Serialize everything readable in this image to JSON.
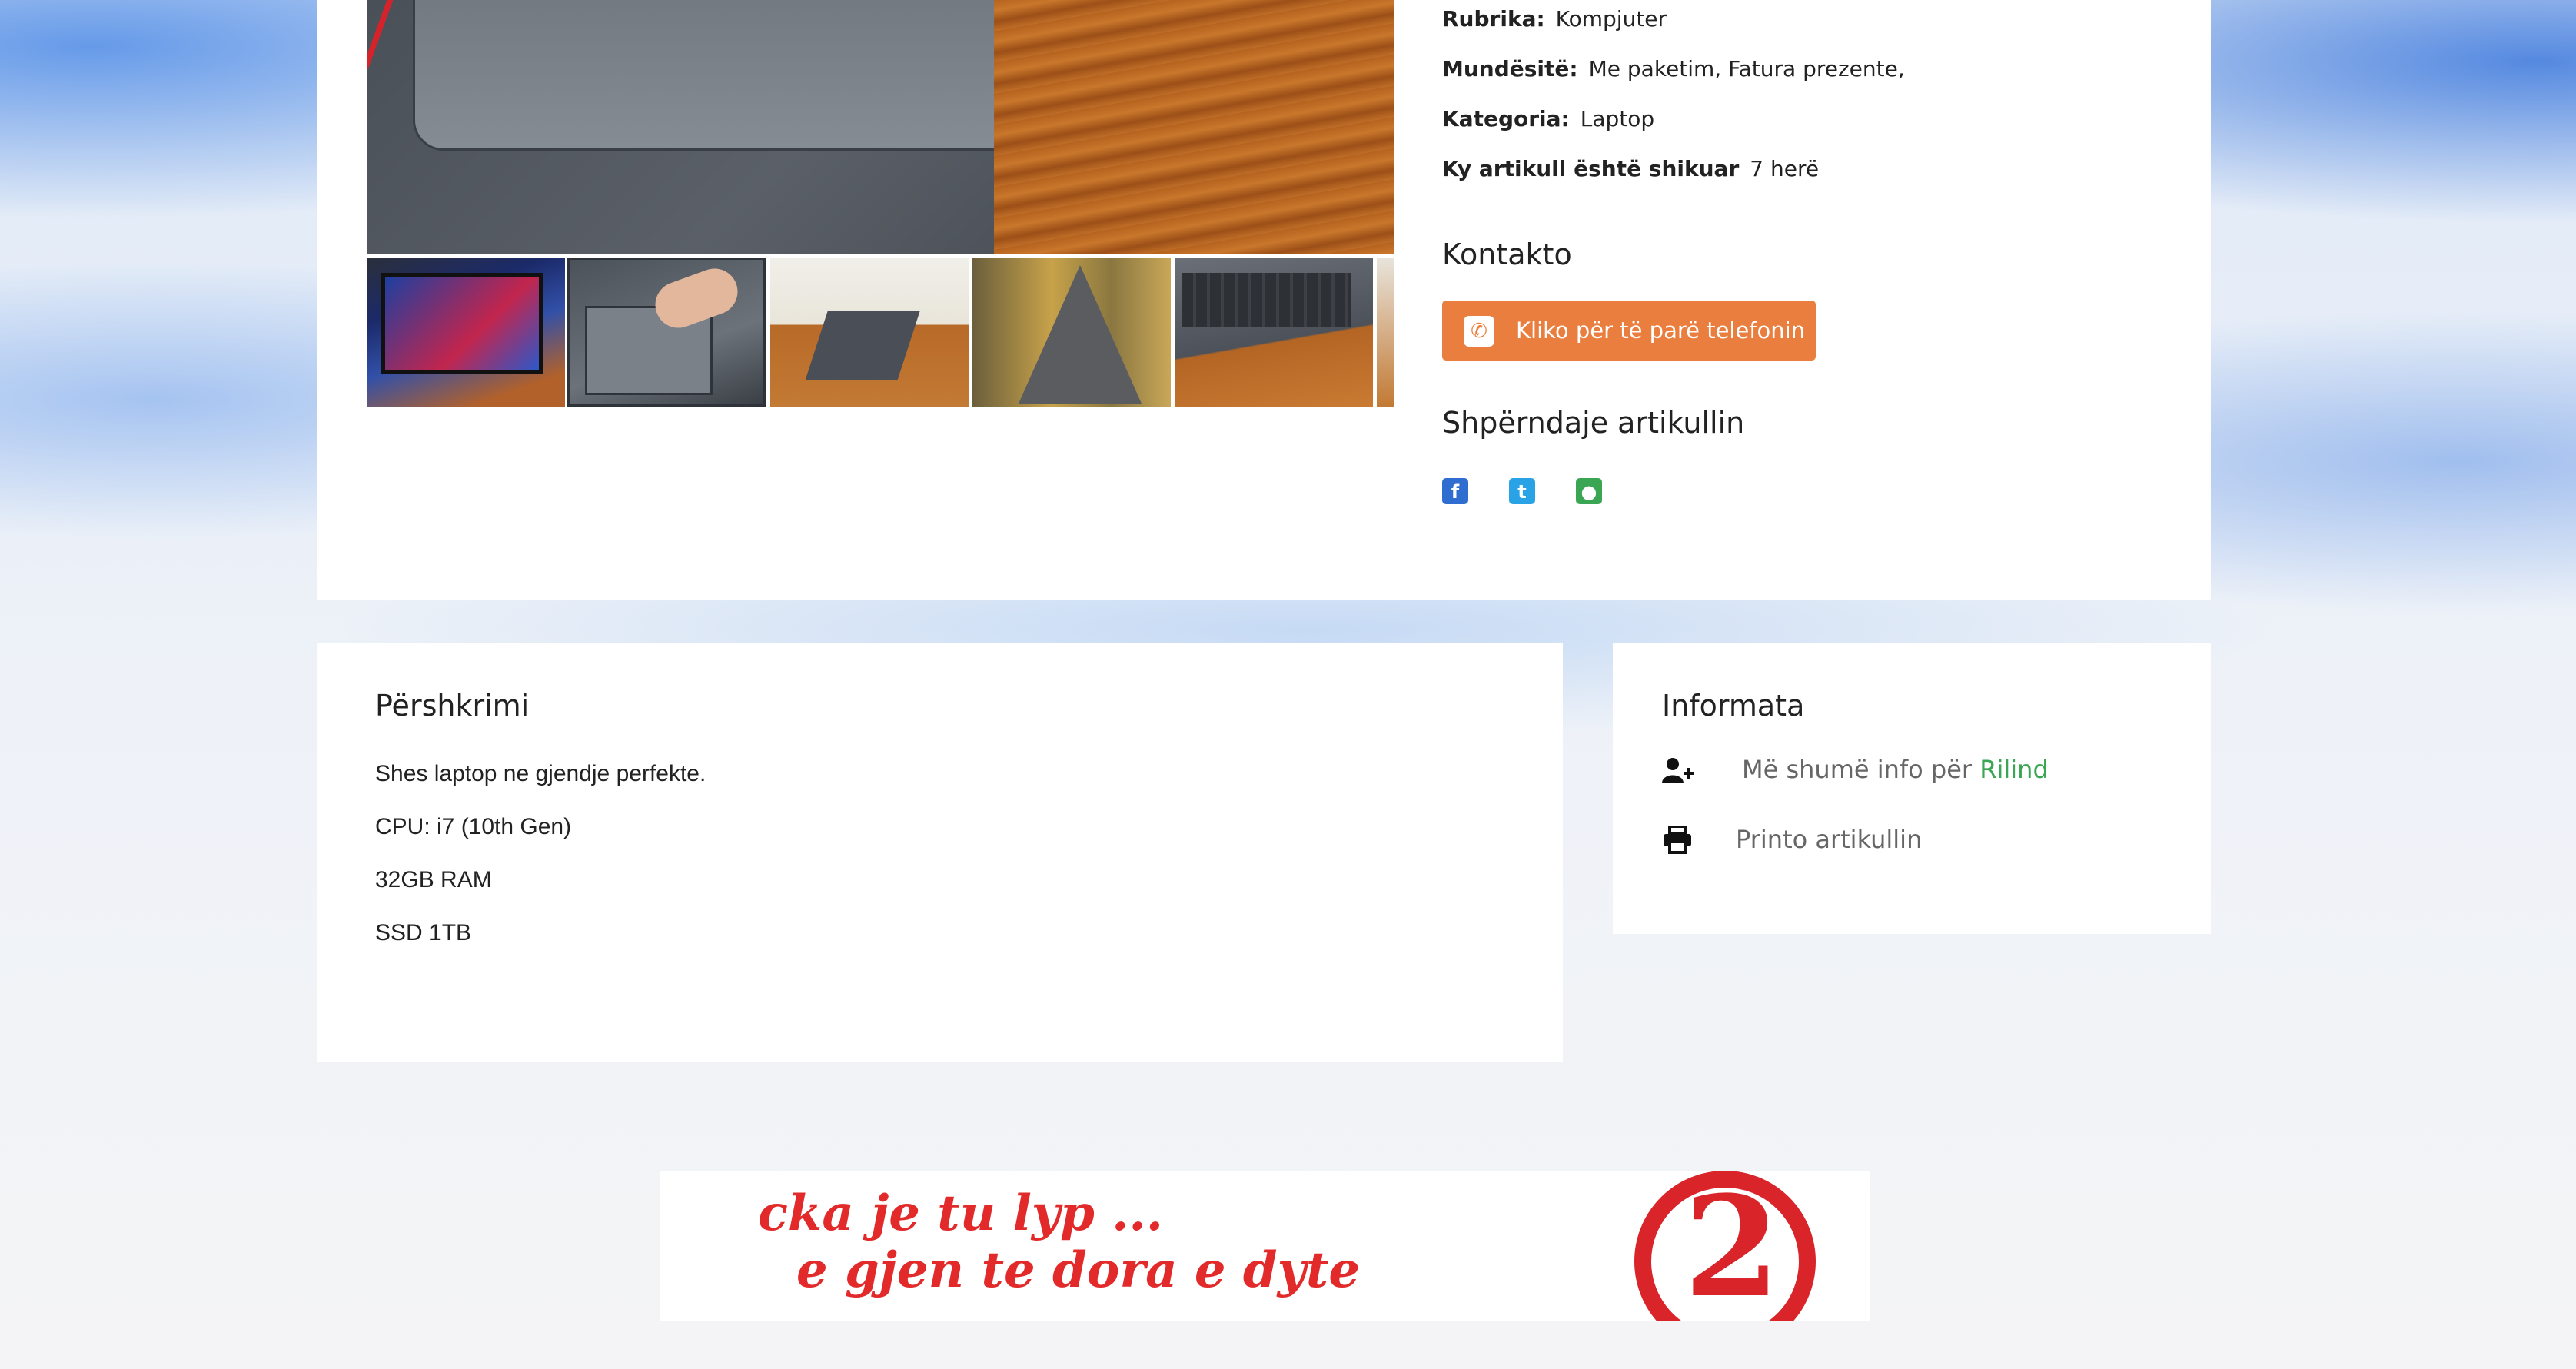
{
  "details": {
    "rubrika_label": "Rubrika:",
    "rubrika_value": "Kompjuter",
    "mundesite_label": "Mundësitë:",
    "mundesite_value": "Me paketim, Fatura prezente,",
    "kategoria_label": "Kategoria:",
    "kategoria_value": "Laptop",
    "shikuar_label": "Ky artikull është shikuar",
    "shikuar_value": "7 herë"
  },
  "contact": {
    "title": "Kontakto",
    "call_button": "Kliko për të parë telefonin"
  },
  "share": {
    "title": "Shpërndaje artikullin",
    "icons": [
      "facebook-icon",
      "twitter-icon",
      "reddit-icon"
    ]
  },
  "description": {
    "title": "Përshkrimi",
    "lines": [
      "Shes laptop ne gjendje perfekte.",
      "CPU: i7 (10th Gen)",
      "32GB RAM",
      "SSD 1TB"
    ]
  },
  "info": {
    "title": "Informata",
    "more_info_prefix": "Më shumë info për",
    "more_info_link": "Rilind",
    "print": "Printo artikullin"
  },
  "banner": {
    "line1": "cka je tu lyp ...",
    "line2": "e gjen te dora e dyte",
    "logo_text": "2"
  },
  "colors": {
    "accent_orange": "#e97e3f",
    "link_green": "#3aa653",
    "facebook": "#2f6ed0",
    "twitter": "#2aa3e6",
    "reddit": "#3aa653",
    "banner_red": "#e22a2a"
  }
}
